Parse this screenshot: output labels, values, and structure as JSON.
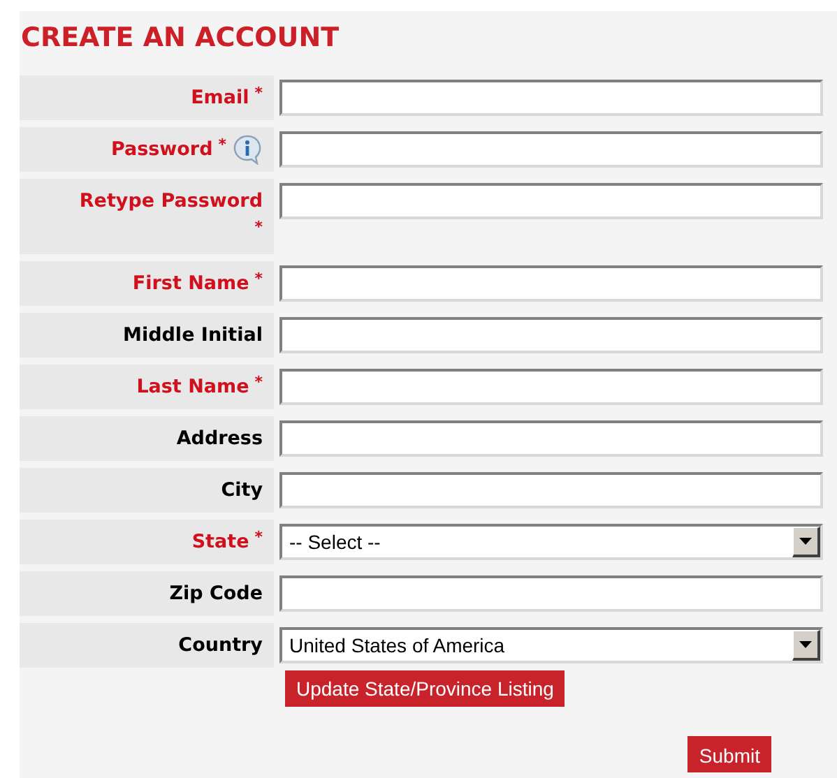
{
  "title": "CREATE AN ACCOUNT",
  "fields": [
    {
      "kind": "text",
      "label": "Email",
      "required": true,
      "mark": "*",
      "info": false,
      "mark_wraps": false
    },
    {
      "kind": "text",
      "label": "Password",
      "required": true,
      "mark": "*",
      "info": true,
      "mark_wraps": false
    },
    {
      "kind": "text",
      "label": "Retype Password",
      "required": true,
      "mark": "*",
      "info": false,
      "mark_wraps": true
    },
    {
      "kind": "text",
      "label": "First Name",
      "required": true,
      "mark": "*",
      "info": false,
      "mark_wraps": false
    },
    {
      "kind": "text",
      "label": "Middle Initial",
      "required": false,
      "info": false,
      "mark_wraps": false
    },
    {
      "kind": "text",
      "label": "Last Name",
      "required": true,
      "mark": "*",
      "info": false,
      "mark_wraps": false
    },
    {
      "kind": "text",
      "label": "Address",
      "required": false,
      "info": false,
      "mark_wraps": false
    },
    {
      "kind": "text",
      "label": "City",
      "required": false,
      "info": false,
      "mark_wraps": false
    },
    {
      "kind": "select",
      "label": "State",
      "required": true,
      "mark": "*",
      "info": false,
      "mark_wraps": false,
      "value": "-- Select --"
    },
    {
      "kind": "text",
      "label": "Zip Code",
      "required": false,
      "info": false,
      "mark_wraps": false
    },
    {
      "kind": "select",
      "label": "Country",
      "required": false,
      "info": false,
      "mark_wraps": false,
      "value": "United States of America"
    }
  ],
  "update_button": "Update State/Province Listing",
  "submit_button": "Submit"
}
